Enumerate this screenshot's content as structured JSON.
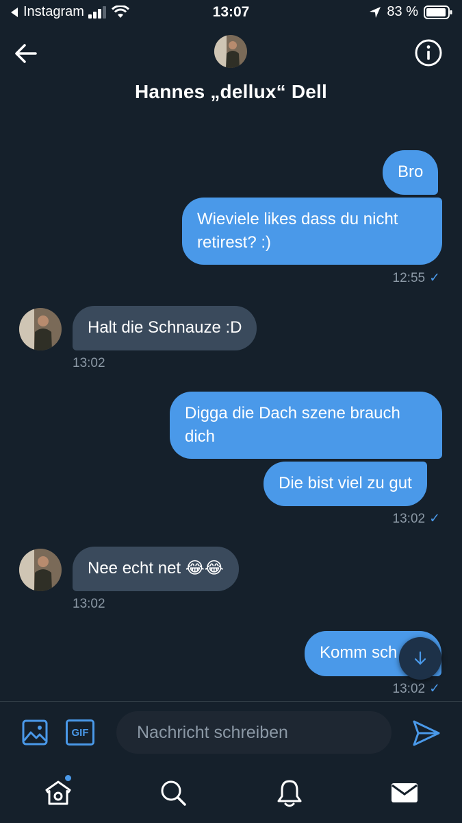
{
  "status_bar": {
    "back_app": "Instagram",
    "time": "13:07",
    "battery": "83 %"
  },
  "header": {
    "title": "Hannes „dellux“ Dell"
  },
  "messages": [
    {
      "dir": "out",
      "text": "Bro"
    },
    {
      "dir": "out",
      "text": "Wieviele likes dass du nicht retirest? :)"
    },
    {
      "dir": "out",
      "time": "12:55"
    },
    {
      "dir": "in",
      "text": "Halt die Schnauze :D",
      "time": "13:02"
    },
    {
      "dir": "out",
      "text": "Digga die Dach szene brauch dich"
    },
    {
      "dir": "out",
      "text": "Die bist viel zu gut",
      "time": "13:02"
    },
    {
      "dir": "in",
      "text": "Nee echt net 😂😂",
      "time": "13:02"
    },
    {
      "dir": "out",
      "text": "Komm sch",
      "time": "13:02"
    }
  ],
  "composer": {
    "gif_label": "GIF",
    "placeholder": "Nachricht schreiben"
  },
  "colors": {
    "background": "#15202b",
    "accent": "#4a99e9",
    "incoming_bubble": "#3a4a5c"
  },
  "icons": {
    "back": "arrow-left-icon",
    "info": "info-icon",
    "media": "image-icon",
    "send": "send-icon",
    "home": "home-icon",
    "search": "search-icon",
    "notifications": "bell-icon",
    "messages": "mail-icon",
    "scroll_down": "arrow-down-icon"
  }
}
